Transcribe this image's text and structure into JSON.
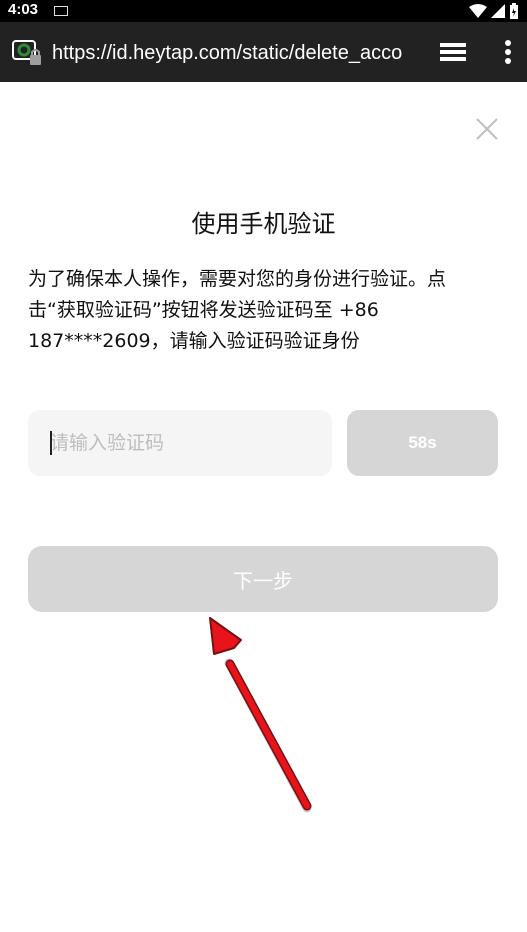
{
  "status_bar": {
    "time": "4:03"
  },
  "browser": {
    "url": "https://id.heytap.com/static/delete_acco"
  },
  "page": {
    "title": "使用手机验证",
    "description_line1": "为了确保本人操作，需要对您的身份进行验证。点",
    "description_line2": "击“获取验证码”按钮将发送验证码至 +86",
    "description_line3": "187****2609，请输入验证码验证身份",
    "code_placeholder": "请输入验证码",
    "countdown_label": "58s",
    "next_label": "下一步"
  },
  "colors": {
    "button_disabled": "#d6d6d6",
    "input_bg": "#f5f5f5",
    "arrow": "#e8141b"
  }
}
